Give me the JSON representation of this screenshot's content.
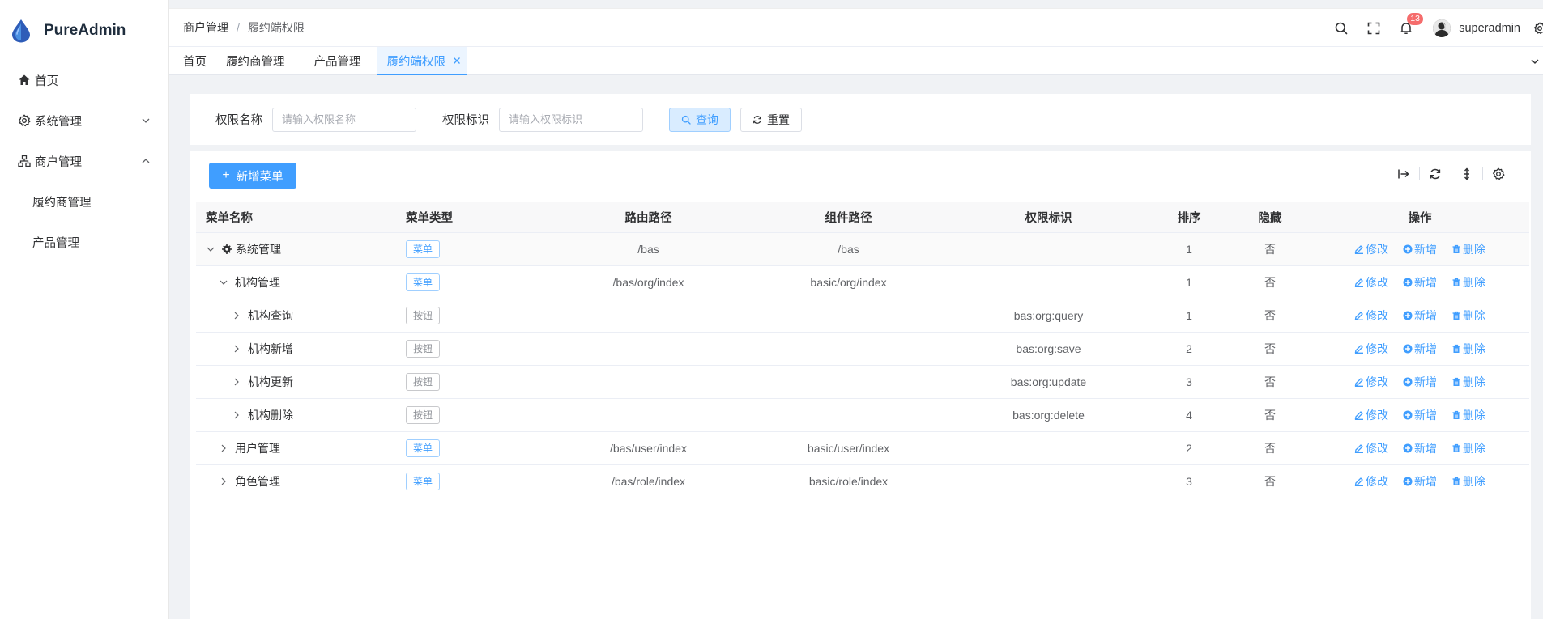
{
  "app": {
    "name": "PureAdmin"
  },
  "sidebar": {
    "items": [
      {
        "label": "首页"
      },
      {
        "label": "系统管理"
      },
      {
        "label": "商户管理"
      }
    ],
    "sub_items": [
      {
        "label": "履约商管理"
      },
      {
        "label": "产品管理"
      }
    ]
  },
  "header": {
    "breadcrumb": [
      "商户管理",
      "履约端权限"
    ],
    "separator": "/",
    "notification_count": "13",
    "username": "superadmin"
  },
  "tabs": [
    {
      "label": "首页"
    },
    {
      "label": "履约商管理"
    },
    {
      "label": "产品管理"
    },
    {
      "label": "履约端权限"
    }
  ],
  "search": {
    "name_label": "权限名称",
    "name_placeholder": "请输入权限名称",
    "code_label": "权限标识",
    "code_placeholder": "请输入权限标识",
    "query_label": "查询",
    "reset_label": "重置"
  },
  "toolbar": {
    "add_label": "新增菜单"
  },
  "table": {
    "columns": [
      "菜单名称",
      "菜单类型",
      "路由路径",
      "组件路径",
      "权限标识",
      "排序",
      "隐藏",
      "操作"
    ],
    "actions": {
      "edit": "修改",
      "add": "新增",
      "delete": "删除"
    },
    "rows": [
      {
        "name": "系统管理",
        "type": "菜单",
        "route": "/bas",
        "component": "/bas",
        "perm": "",
        "sort": "1",
        "hidden": "否"
      },
      {
        "name": "机构管理",
        "type": "菜单",
        "route": "/bas/org/index",
        "component": "basic/org/index",
        "perm": "",
        "sort": "1",
        "hidden": "否"
      },
      {
        "name": "机构查询",
        "type": "按钮",
        "route": "",
        "component": "",
        "perm": "bas:org:query",
        "sort": "1",
        "hidden": "否"
      },
      {
        "name": "机构新增",
        "type": "按钮",
        "route": "",
        "component": "",
        "perm": "bas:org:save",
        "sort": "2",
        "hidden": "否"
      },
      {
        "name": "机构更新",
        "type": "按钮",
        "route": "",
        "component": "",
        "perm": "bas:org:update",
        "sort": "3",
        "hidden": "否"
      },
      {
        "name": "机构删除",
        "type": "按钮",
        "route": "",
        "component": "",
        "perm": "bas:org:delete",
        "sort": "4",
        "hidden": "否"
      },
      {
        "name": "用户管理",
        "type": "菜单",
        "route": "/bas/user/index",
        "component": "basic/user/index",
        "perm": "",
        "sort": "2",
        "hidden": "否"
      },
      {
        "name": "角色管理",
        "type": "菜单",
        "route": "/bas/role/index",
        "component": "basic/role/index",
        "perm": "",
        "sort": "3",
        "hidden": "否"
      }
    ]
  },
  "colors": {
    "primary": "#409eff",
    "danger_badge": "#f56c6c"
  }
}
